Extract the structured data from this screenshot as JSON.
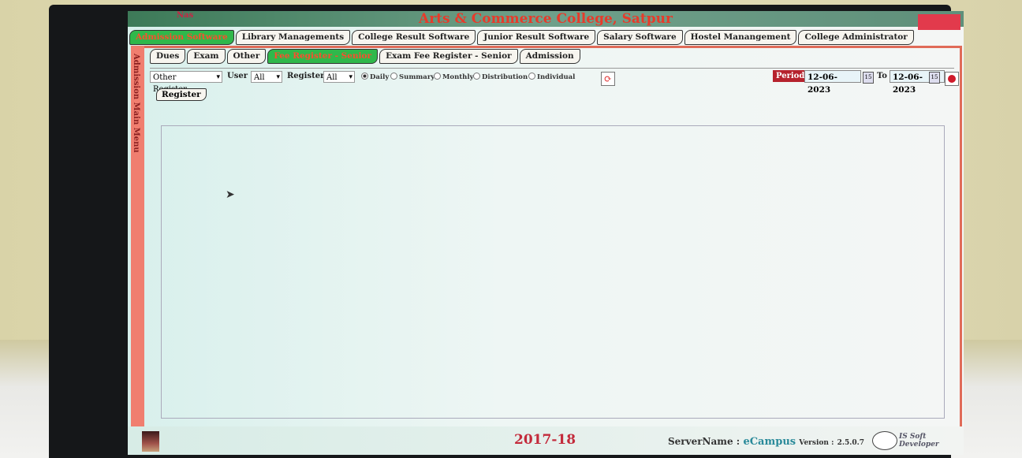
{
  "app": {
    "title": "Arts & Commerce College, Satpur",
    "user": "Nas"
  },
  "main_tabs": [
    {
      "label": "Admission Software",
      "active": true
    },
    {
      "label": "Library Managements",
      "active": false
    },
    {
      "label": "College Result Software",
      "active": false
    },
    {
      "label": "Junior Result Software",
      "active": false
    },
    {
      "label": "Salary Software",
      "active": false
    },
    {
      "label": "Hostel Manangement",
      "active": false
    },
    {
      "label": "College Administrator",
      "active": false
    }
  ],
  "side_menu": {
    "label": "Admission Main Menu"
  },
  "sub_tabs": [
    {
      "label": "Dues",
      "active": false
    },
    {
      "label": "Exam",
      "active": false
    },
    {
      "label": "Other",
      "active": false
    },
    {
      "label": "Fee Register - Senior",
      "active": true
    },
    {
      "label": "Exam Fee Register - Senior",
      "active": false
    },
    {
      "label": "Admission",
      "active": false
    }
  ],
  "toolbar": {
    "report_select": "Other Register",
    "user_label": "User",
    "user_value": "All",
    "register_label": "Register",
    "register_value": "All",
    "radios": [
      {
        "label": "Daily",
        "checked": true
      },
      {
        "label": "Summary",
        "checked": false
      },
      {
        "label": "Monthly",
        "checked": false
      },
      {
        "label": "Distribution",
        "checked": false
      },
      {
        "label": "Individual",
        "checked": false
      }
    ],
    "period_label": "Period",
    "from_date": "12-06-2023",
    "to_label": "To",
    "to_date": "12-06-2023",
    "calendar_icon_text": "15"
  },
  "register_button": "Register",
  "status": {
    "year": "2017-18",
    "server_label": "ServerName :",
    "server_value": "eCampus",
    "version_label": "Version :",
    "version_value": "2.5.0.7",
    "logo_text": "IS Soft Developer"
  },
  "colors": {
    "accent_red": "#c32a3b",
    "active_tab": "#2fb84b",
    "frame": "#e06b58"
  }
}
